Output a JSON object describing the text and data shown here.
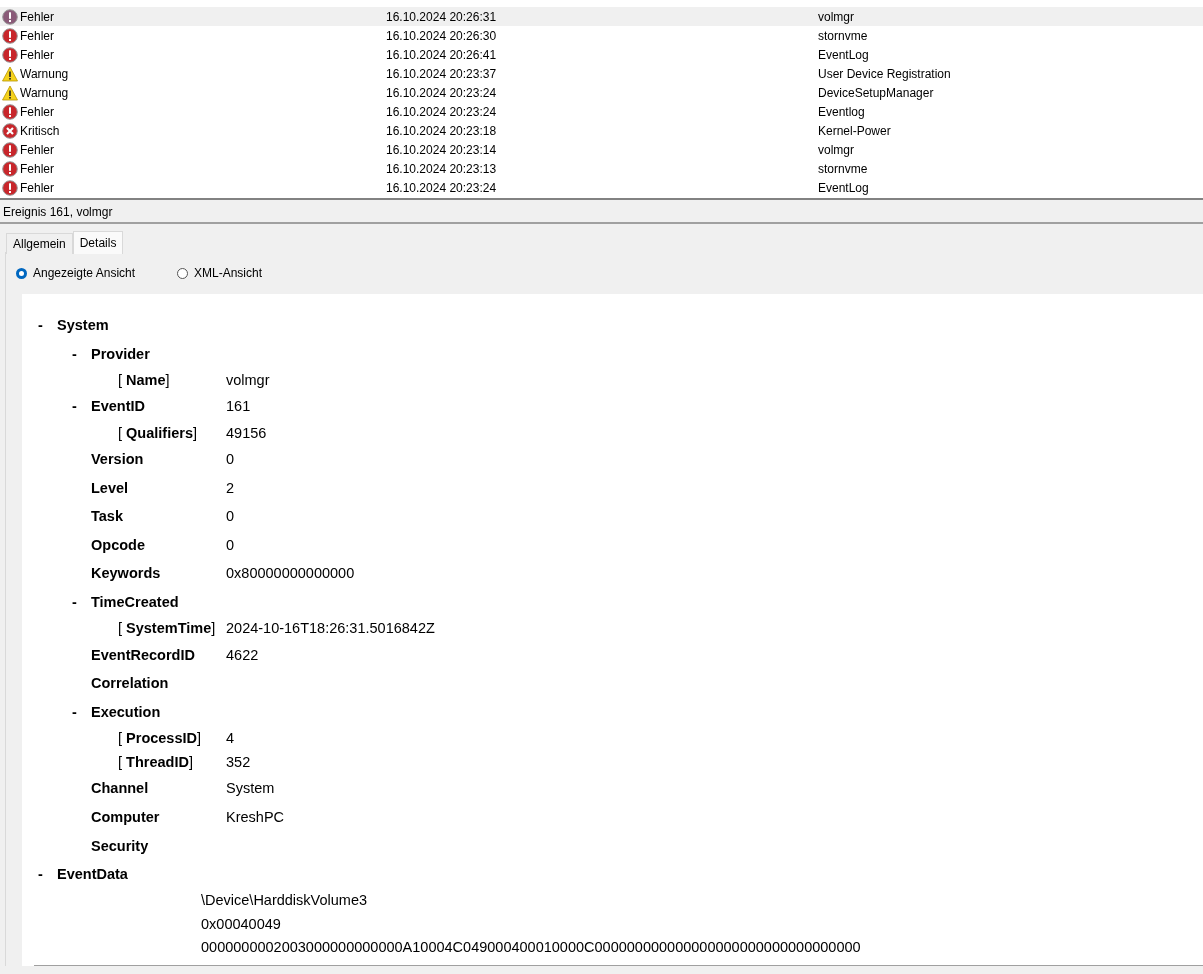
{
  "events": [
    {
      "kind": "error",
      "level": "Fehler",
      "date": "16.10.2024 20:26:31",
      "source": "volmgr",
      "selected": true
    },
    {
      "kind": "error",
      "level": "Fehler",
      "date": "16.10.2024 20:26:30",
      "source": "stornvme",
      "selected": false
    },
    {
      "kind": "error",
      "level": "Fehler",
      "date": "16.10.2024 20:26:41",
      "source": "EventLog",
      "selected": false
    },
    {
      "kind": "warning",
      "level": "Warnung",
      "date": "16.10.2024 20:23:37",
      "source": "User Device Registration",
      "selected": false
    },
    {
      "kind": "warning",
      "level": "Warnung",
      "date": "16.10.2024 20:23:24",
      "source": "DeviceSetupManager",
      "selected": false
    },
    {
      "kind": "error",
      "level": "Fehler",
      "date": "16.10.2024 20:23:24",
      "source": "Eventlog",
      "selected": false
    },
    {
      "kind": "critical",
      "level": "Kritisch",
      "date": "16.10.2024 20:23:18",
      "source": "Kernel-Power",
      "selected": false
    },
    {
      "kind": "error",
      "level": "Fehler",
      "date": "16.10.2024 20:23:14",
      "source": "volmgr",
      "selected": false
    },
    {
      "kind": "error",
      "level": "Fehler",
      "date": "16.10.2024 20:23:13",
      "source": "stornvme",
      "selected": false
    },
    {
      "kind": "error",
      "level": "Fehler",
      "date": "16.10.2024 20:23:24",
      "source": "EventLog",
      "selected": false
    }
  ],
  "detail_title": "Ereignis 161, volmgr",
  "tabs": [
    {
      "label": "Allgemein",
      "selected": false
    },
    {
      "label": "Details",
      "selected": true
    }
  ],
  "views": [
    {
      "label": "Angezeigte Ansicht",
      "selected": true
    },
    {
      "label": "XML-Ansicht",
      "selected": false
    }
  ],
  "tree": [
    {
      "kind": "node",
      "toggle": "-",
      "name": "System",
      "children": [
        {
          "kind": "node",
          "toggle": "-",
          "name": "Provider",
          "children": [
            {
              "kind": "attr",
              "name": "[ **Name**]",
              "value": "volmgr"
            }
          ]
        },
        {
          "kind": "node",
          "toggle": "-",
          "name": "EventID",
          "value": "161",
          "children": [
            {
              "kind": "attr",
              "name": "[ **Qualifiers**]",
              "value": "49156"
            }
          ]
        },
        {
          "kind": "node",
          "name": "Version",
          "value": "0"
        },
        {
          "kind": "node",
          "name": "Level",
          "value": "2"
        },
        {
          "kind": "node",
          "name": "Task",
          "value": "0"
        },
        {
          "kind": "node",
          "name": "Opcode",
          "value": "0"
        },
        {
          "kind": "node",
          "name": "Keywords",
          "value": "0x80000000000000"
        },
        {
          "kind": "node",
          "toggle": "-",
          "name": "TimeCreated",
          "children": [
            {
              "kind": "attr",
              "name": "[ **SystemTime**]",
              "value": "2024-10-16T18:26:31.5016842Z"
            }
          ]
        },
        {
          "kind": "node",
          "name": "EventRecordID",
          "value": "4622"
        },
        {
          "kind": "node",
          "name": "Correlation"
        },
        {
          "kind": "node",
          "toggle": "-",
          "name": "Execution",
          "children": [
            {
              "kind": "attr",
              "name": "[ **ProcessID**]",
              "value": "4"
            },
            {
              "kind": "attr",
              "name": "[ **ThreadID**]",
              "value": "352"
            }
          ]
        },
        {
          "kind": "node",
          "name": "Channel",
          "value": "System"
        },
        {
          "kind": "node",
          "name": "Computer",
          "value": "KreshPC"
        },
        {
          "kind": "node",
          "name": "Security"
        }
      ]
    },
    {
      "kind": "node",
      "toggle": "-",
      "name": "EventData",
      "data": [
        "\\Device\\HarddiskVolume3",
        "0x00040049",
        "0000000002003000000000000A10004C049000400010000C000000000000000000000000000000000"
      ]
    }
  ]
}
